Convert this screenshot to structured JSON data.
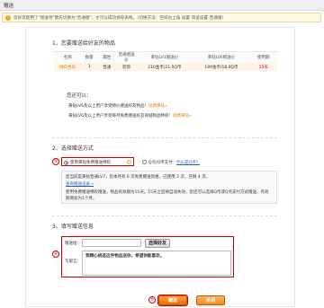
{
  "header": {
    "title": "赠送"
  },
  "notice": {
    "text": "您好友使用了\"增送领\"需先切换为\"普通版\"，才可以成功保存表格。（切换方法：空间右上角 设置-浏览设置-普通版）"
  },
  "section1": {
    "title": "1、您要赠送给好友的物品",
    "columns": [
      "名称",
      "数量",
      "属性",
      "普通赠送价",
      "黄钻LV1赠送价",
      "黄钻LV6赠送价",
      "使用期"
    ],
    "row": [
      "绿白色彩",
      "1",
      "普通",
      "装饰",
      "210金币/21.0Q币",
      "189金币/18.9Q币",
      "15天"
    ]
  },
  "also": {
    "title": "您还可以：",
    "line1_text": "黄钻LV6及以上用户享受特价赠送好友物品！",
    "line1_link": "续费黄钻»",
    "line2_text": "黄钻LV6及以上用户享受每月免费赠送好友商城物品特权！",
    "line2_link": "续费黄钻»"
  },
  "section2": {
    "title": "2、选择赠送方式",
    "option1": "使用黄钻免费赠送特权",
    "option2": "Q点/Q币支付",
    "option2_link": "什么是Q点？",
    "info1": "您当前是黄钻普通LV7，您本月有 6 次免费赠送资格，已使用 2 次，还剩 4 次。",
    "info1_link": "查询赠送记录 »",
    "info2": "使用免费赠送特权赠送，物品有效期为15天。15天之后将自动失效，您还可以选择Q币或Q点支付方式赠送，有效期增加为1个月。"
  },
  "section3": {
    "title": "3、填写赠送信息",
    "to_label": "赠送给：",
    "choose_friend": "选择好友",
    "msg_label": "写留言：",
    "msg_value": "我精心挑选这件物品送你，希望你能喜欢。"
  },
  "footer": {
    "submit": "赠送",
    "cancel": "关闭"
  },
  "callouts": {
    "c3": "③",
    "c4": "④",
    "c5": "⑤"
  }
}
